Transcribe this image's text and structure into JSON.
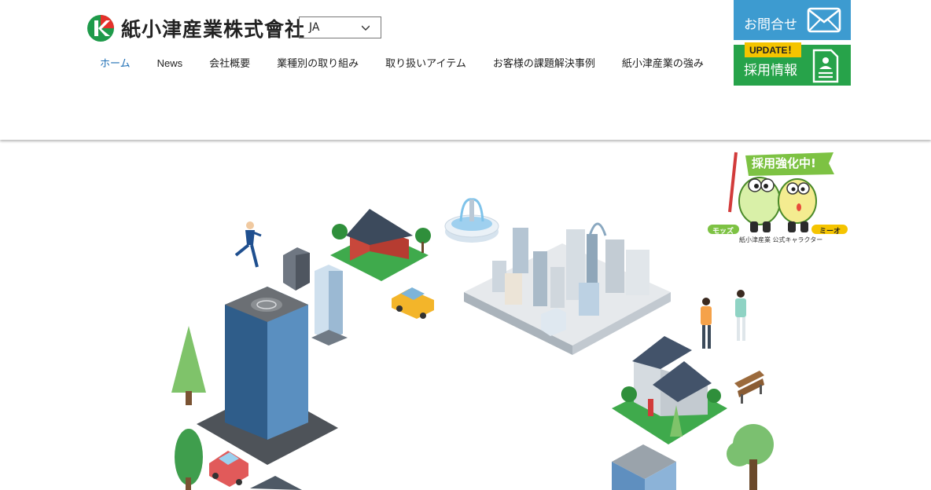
{
  "company": {
    "name": "紙小津産業株式會社",
    "logo_letter": "K"
  },
  "language": {
    "selected": "JA"
  },
  "nav": [
    {
      "label": "ホーム",
      "active": true
    },
    {
      "label": "News"
    },
    {
      "label": "会社概要"
    },
    {
      "label": "業種別の取り組み"
    },
    {
      "label": "取り扱いアイテム"
    },
    {
      "label": "お客様の課題解決事例"
    },
    {
      "label": "紙小津産業の強み"
    }
  ],
  "contact": {
    "label": "お問合せ"
  },
  "recruit": {
    "badge": "UPDATE！",
    "label": "採用情報"
  },
  "mascot": {
    "banner": "採用強化中!",
    "name_left": "モッズ",
    "name_right": "ミーオ",
    "caption": "紙小津産業 公式キャラクター"
  },
  "colors": {
    "accent": "#1f6fb5",
    "contact_bg": "#3d9bd0",
    "recruit_bg": "#27a34a",
    "update_badge": "#f5c400"
  }
}
